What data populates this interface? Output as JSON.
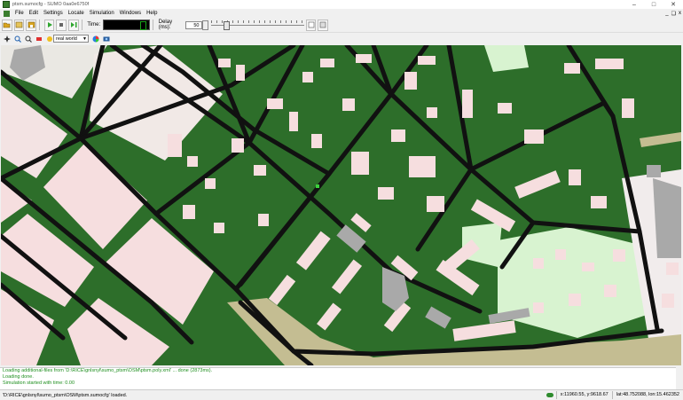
{
  "window": {
    "title": "ptsm.sumocfg - SUMO 0aa0e6750f",
    "controls": {
      "minimize": "–",
      "maximize": "□",
      "close": "✕"
    },
    "mdi_controls": {
      "minimize": "_",
      "restore": "❏",
      "close": "x"
    }
  },
  "menu": {
    "items": [
      "File",
      "Edit",
      "Settings",
      "Locate",
      "Simulation",
      "Windows",
      "Help"
    ]
  },
  "toolbar": {
    "time_label": "Time:",
    "delay_label": "Delay (ms):",
    "delay_value": "50",
    "delay_slider_level": 0.12,
    "buttons": [
      "open-icon",
      "reload-icon",
      "save-icon",
      "play-icon",
      "stop-icon",
      "step-icon"
    ]
  },
  "view_toolbar": {
    "scheme_value": "real world",
    "icons": [
      "recenter-icon",
      "zoom-icon",
      "locate-junction-icon",
      "locate-vehicle-icon",
      "locate-stop-icon",
      "color-wheel-icon",
      "screenshot-icon"
    ]
  },
  "messages": [
    "Loading additional-files from 'D:\\RICE\\gnlsnyl\\sumo_ptsm\\OSM\\ptsm.poly.xml' ... done (2873ms).",
    "Loading done.",
    "Simulation started with time: 0.00"
  ],
  "status": {
    "message": "'D:\\RICE\\gnlsnyl\\sumo_ptsm\\OSM\\ptsm.sumocfg' loaded.",
    "coords": "x:11960.55, y:9618.67",
    "geo": "lat:48.752088, lon:15.462352"
  },
  "colors": {
    "grass": "#2d6e2a",
    "road": "#111111",
    "building": "#f6dedf",
    "residential": "#eae8e3",
    "park": "#d8f3d0",
    "sand": "#c4bd92",
    "gray_building": "#a9a9a9"
  }
}
